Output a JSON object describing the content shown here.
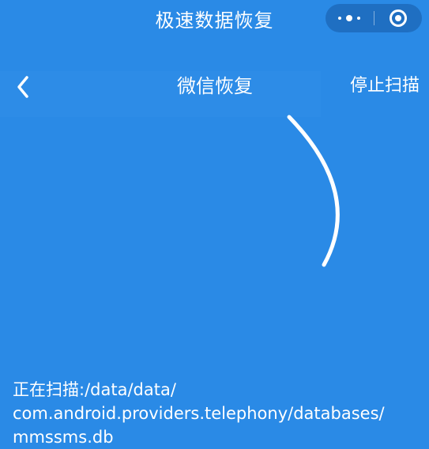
{
  "app": {
    "title": "极速数据恢复"
  },
  "navbar": {
    "title": "微信恢复",
    "stop_label": "停止扫描"
  },
  "status": {
    "line1": "正在扫描:/data/data/",
    "line2": "com.android.providers.telephony/databases/",
    "line3": "mmssms.db"
  },
  "colors": {
    "background": "#2a8ae6",
    "capsule": "#1f6fc2",
    "text": "#ffffff"
  },
  "icons": {
    "back": "chevron-left-icon",
    "more": "more-dots-icon",
    "close": "target-circle-icon",
    "loading": "loading-arc"
  }
}
